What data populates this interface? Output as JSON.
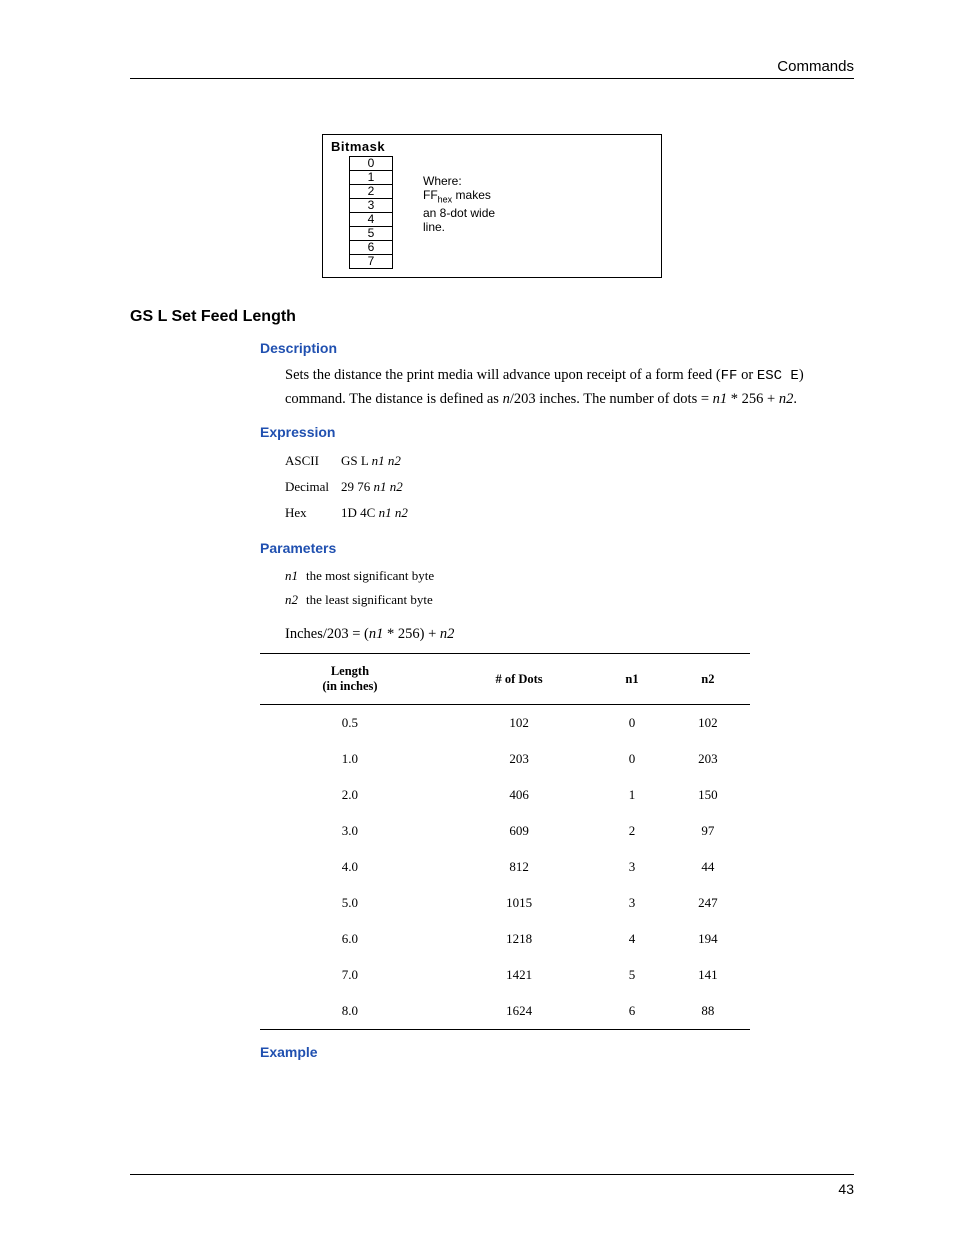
{
  "header": {
    "section": "Commands"
  },
  "footer": {
    "page_number": "43"
  },
  "bitmask": {
    "title": "Bitmask",
    "cells": [
      "0",
      "1",
      "2",
      "3",
      "4",
      "5",
      "6",
      "7"
    ],
    "note_line1": "Where:",
    "note_line2_a": "FF",
    "note_line2_sub": "hex",
    "note_line2_b": " makes",
    "note_line3": "an 8-dot wide",
    "note_line4": "line."
  },
  "command": {
    "title": "GS L Set Feed Length",
    "description_heading": "Description",
    "description_pre": "Sets the distance the print media will advance upon receipt of a form feed (",
    "description_ff": "FF",
    "description_or": " or ",
    "description_esc": "ESC E",
    "description_post1": ") command. The distance is defined as ",
    "description_n203": "n",
    "description_post2": "/203 inches. The number of dots = ",
    "description_n1": "n1",
    "description_times": " * 256 + ",
    "description_n2": "n2",
    "description_end": ".",
    "expression_heading": "Expression",
    "expr": {
      "ascii_label": "ASCII",
      "ascii_val_pre": "GS L ",
      "ascii_val_ital": "n1 n2",
      "decimal_label": "Decimal",
      "decimal_val_pre": "29 76 ",
      "decimal_val_ital": "n1 n2",
      "hex_label": "Hex",
      "hex_val_pre": "1D 4C ",
      "hex_val_ital": "n1 n2"
    },
    "parameters_heading": "Parameters",
    "params": {
      "n1_term": "n1",
      "n1_def": "the most significant byte",
      "n2_term": "n2",
      "n2_def": "the least significant byte"
    },
    "formula_pre": "Inches/203 = (",
    "formula_n1": "n1",
    "formula_mid": " * 256) + ",
    "formula_n2": "n2",
    "example_heading": "Example"
  },
  "chart_data": {
    "type": "table",
    "columns": [
      "Length (in inches)",
      "# of Dots",
      "n1",
      "n2"
    ],
    "rows": [
      {
        "length": "0.5",
        "dots": "102",
        "n1": "0",
        "n2": "102"
      },
      {
        "length": "1.0",
        "dots": "203",
        "n1": "0",
        "n2": "203"
      },
      {
        "length": "2.0",
        "dots": "406",
        "n1": "1",
        "n2": "150"
      },
      {
        "length": "3.0",
        "dots": "609",
        "n1": "2",
        "n2": "97"
      },
      {
        "length": "4.0",
        "dots": "812",
        "n1": "3",
        "n2": "44"
      },
      {
        "length": "5.0",
        "dots": "1015",
        "n1": "3",
        "n2": "247"
      },
      {
        "length": "6.0",
        "dots": "1218",
        "n1": "4",
        "n2": "194"
      },
      {
        "length": "7.0",
        "dots": "1421",
        "n1": "5",
        "n2": "141"
      },
      {
        "length": "8.0",
        "dots": "1624",
        "n1": "6",
        "n2": "88"
      }
    ],
    "header": {
      "length_l1": "Length",
      "length_l2": "(in inches)",
      "dots": "# of Dots",
      "n1": "n1",
      "n2": "n2"
    }
  }
}
